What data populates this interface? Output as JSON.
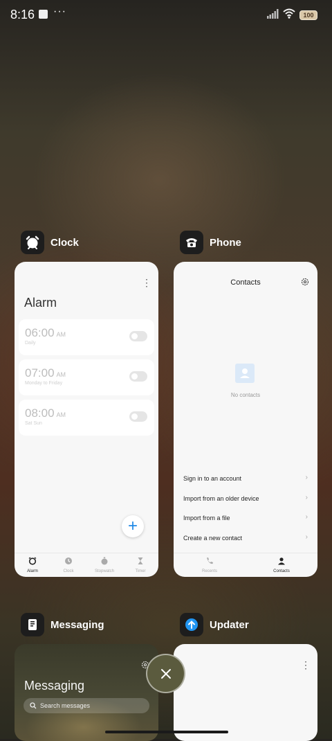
{
  "status_bar": {
    "time": "8:16",
    "more": "···",
    "battery": "100"
  },
  "clock": {
    "app_name": "Clock",
    "title": "Alarm",
    "alarms": [
      {
        "time": "06:00",
        "ampm": "AM",
        "repeat": "Daily"
      },
      {
        "time": "07:00",
        "ampm": "AM",
        "repeat": "Monday to Friday"
      },
      {
        "time": "08:00",
        "ampm": "AM",
        "repeat": "Sat Sun"
      }
    ],
    "add_label": "+",
    "nav": [
      "Alarm",
      "Clock",
      "Stopwatch",
      "Timer"
    ]
  },
  "phone": {
    "app_name": "Phone",
    "title": "Contacts",
    "empty": "No contacts",
    "actions": [
      "Sign in to an account",
      "Import from an older device",
      "Import from a file",
      "Create a new contact"
    ],
    "nav": [
      "Recents",
      "Contacts"
    ]
  },
  "messaging": {
    "app_name": "Messaging",
    "title": "Messaging",
    "search_placeholder": "Search messages"
  },
  "updater": {
    "app_name": "Updater"
  },
  "colors": {
    "accent": "#1e88e5",
    "close_button": "#5b5b3e"
  }
}
